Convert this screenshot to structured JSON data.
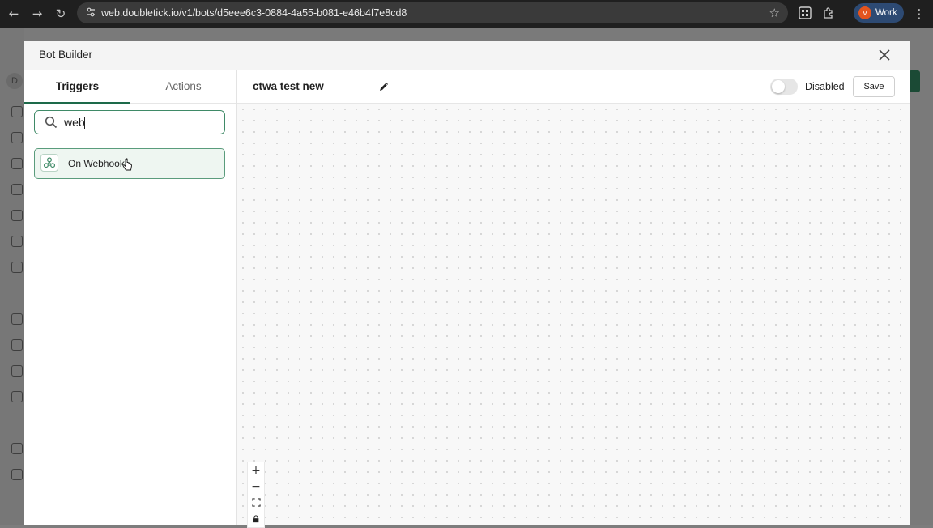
{
  "browser": {
    "url": "web.doubletick.io/v1/bots/d5eee6c3-0884-4a55-b081-e46b4f7e8cd8",
    "profile_initial": "V",
    "profile_label": "Work"
  },
  "background": {
    "avatar_initial": "D"
  },
  "modal": {
    "title": "Bot Builder",
    "tabs": [
      {
        "label": "Triggers",
        "active": true
      },
      {
        "label": "Actions",
        "active": false
      }
    ],
    "search": {
      "value": "web"
    },
    "results": [
      {
        "label": "On Webhook",
        "icon": "webhook-icon"
      }
    ],
    "bot_name": "ctwa test new",
    "toggle": {
      "label": "Disabled",
      "enabled": false
    },
    "save_label": "Save",
    "zoom_controls": [
      "zoom-in-icon",
      "zoom-out-icon",
      "fit-view-icon",
      "lock-icon"
    ]
  },
  "colors": {
    "accent": "#1d6a4a",
    "selected_bg": "#eef6f1",
    "selected_border": "#5a9c7c"
  }
}
